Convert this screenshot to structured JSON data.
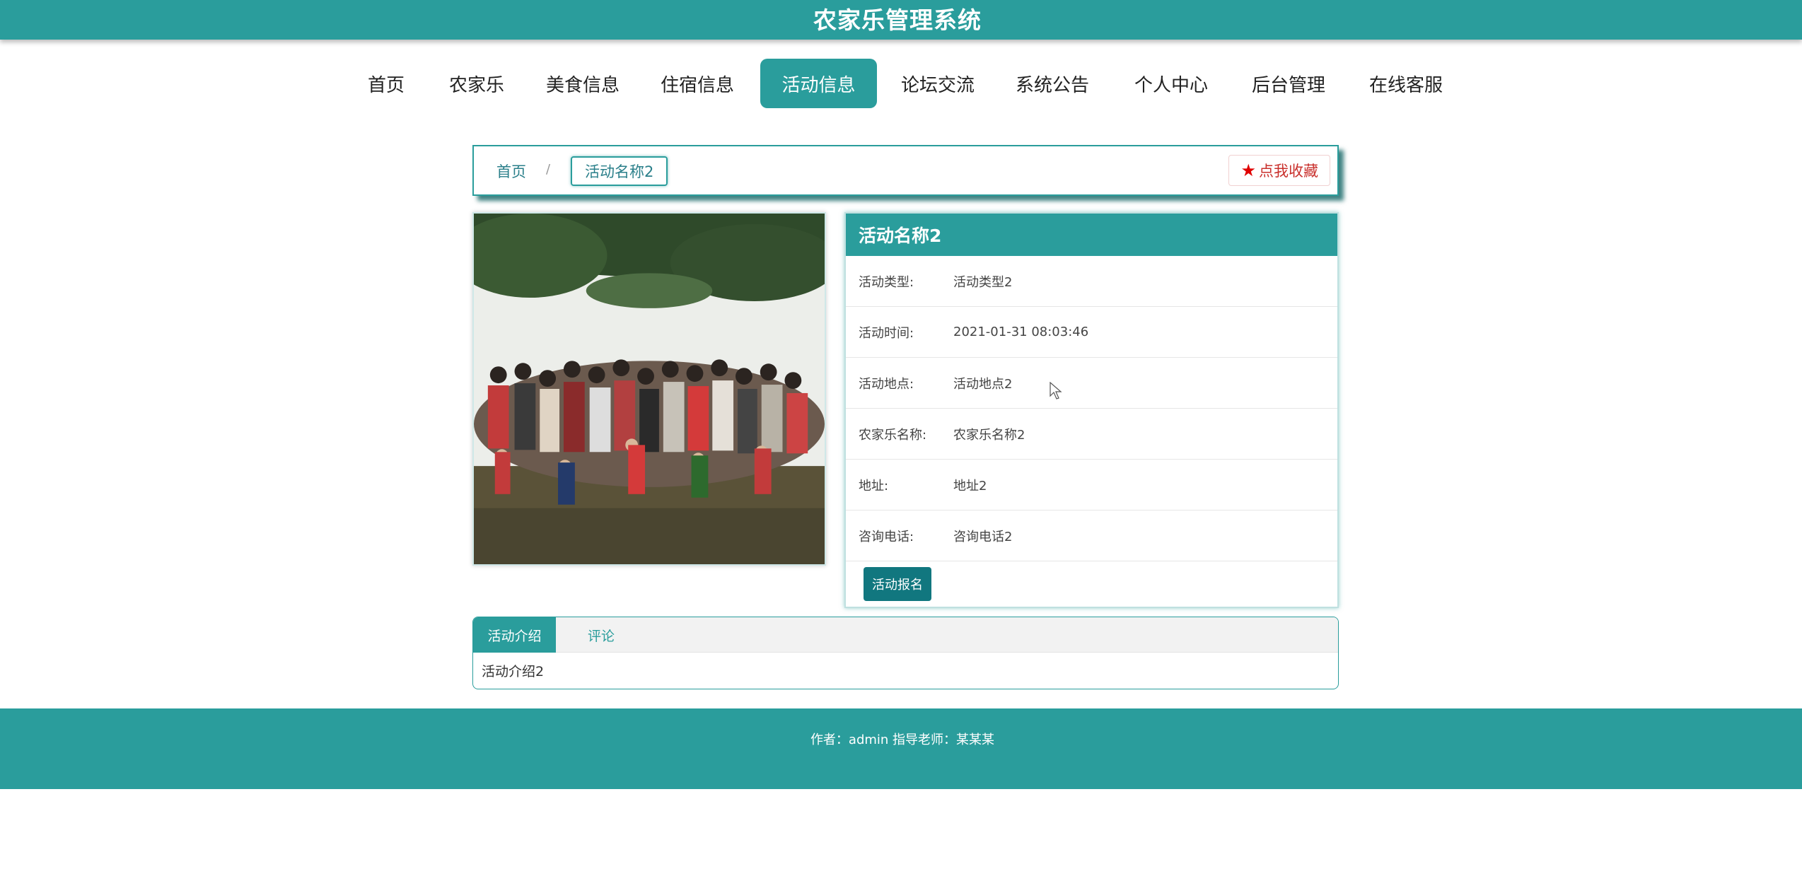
{
  "header": {
    "title": "农家乐管理系统"
  },
  "nav": {
    "items": [
      {
        "label": "首页"
      },
      {
        "label": "农家乐"
      },
      {
        "label": "美食信息"
      },
      {
        "label": "住宿信息"
      },
      {
        "label": "活动信息"
      },
      {
        "label": "论坛交流"
      },
      {
        "label": "系统公告"
      },
      {
        "label": "个人中心"
      },
      {
        "label": "后台管理"
      },
      {
        "label": "在线客服"
      }
    ],
    "active": "活动信息"
  },
  "breadcrumb": {
    "home": "首页",
    "separator": "/",
    "current": "活动名称2"
  },
  "favorite": {
    "label": "点我收藏",
    "icon": "star-icon"
  },
  "detail": {
    "title": "活动名称2",
    "rows": [
      {
        "label": "活动类型:",
        "value": "活动类型2"
      },
      {
        "label": "活动时间:",
        "value": "2021-01-31 08:03:46"
      },
      {
        "label": "活动地点:",
        "value": "活动地点2"
      },
      {
        "label": "农家乐名称:",
        "value": "农家乐名称2"
      },
      {
        "label": "地址:",
        "value": "地址2"
      },
      {
        "label": "咨询电话:",
        "value": "咨询电话2"
      }
    ],
    "signup_label": "活动报名"
  },
  "tabs": {
    "items": [
      {
        "label": "活动介绍"
      },
      {
        "label": "评论"
      }
    ],
    "content": "活动介绍2"
  },
  "footer": {
    "text": "作者：admin 指导老师：某某某"
  },
  "colors": {
    "primary": "#2a9d9c",
    "button": "#11777f",
    "favorite": "#e00000"
  }
}
